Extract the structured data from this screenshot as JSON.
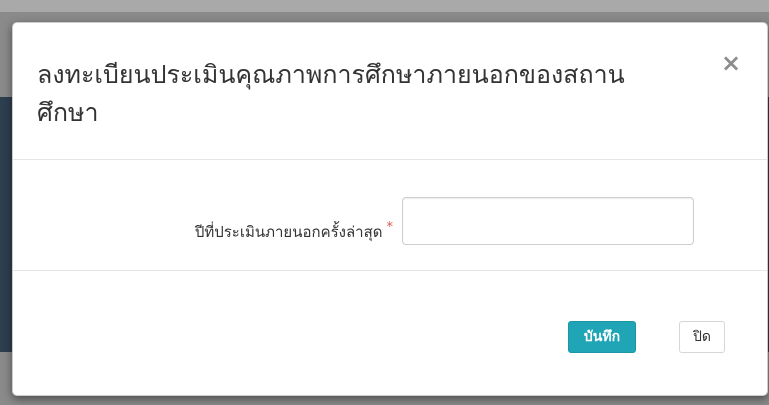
{
  "modal": {
    "title": "ลงทะเบียนประเมินคุณภาพการศึกษาภายนอกของสถานศึกษา",
    "close_glyph": "×"
  },
  "form": {
    "last_external_assessment_year": {
      "label": "ปีที่ประเมินภายนอกครั้งล่าสุด",
      "required_mark": "*",
      "value": ""
    }
  },
  "footer": {
    "save_label": "บันทึก",
    "close_label": "ปิด"
  },
  "colors": {
    "primary_button": "#1fa5b5",
    "required_mark": "#d9534f",
    "background_band": "#2d3e4e"
  },
  "icons": {
    "close": "close-icon"
  }
}
